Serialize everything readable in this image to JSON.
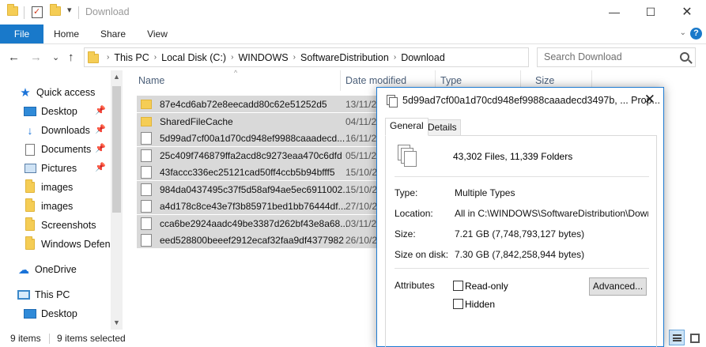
{
  "window": {
    "title": "Download",
    "minimize_glyph": "—",
    "maximize_glyph": "☐",
    "close_glyph": "✕"
  },
  "quick_access_toolbar": {
    "dropdown_glyph": "▾"
  },
  "ribbon": {
    "tabs": [
      "File",
      "Home",
      "Share",
      "View"
    ],
    "expand_glyph": "⌄",
    "help_glyph": "?"
  },
  "navigation": {
    "back_glyph": "←",
    "forward_glyph": "→",
    "recent_glyph": "⌄",
    "up_glyph": "↑",
    "breadcrumb": [
      "This PC",
      "Local Disk (C:)",
      "WINDOWS",
      "SoftwareDistribution",
      "Download"
    ],
    "breadcrumb_separator": "›",
    "search_placeholder": "Search Download"
  },
  "nav_pane": {
    "items": [
      {
        "label": "Quick access",
        "icon": "star-icon",
        "pinned": false
      },
      {
        "label": "Desktop",
        "icon": "desktop-icon",
        "pinned": true
      },
      {
        "label": "Downloads",
        "icon": "download-icon",
        "pinned": true
      },
      {
        "label": "Documents",
        "icon": "documents-icon",
        "pinned": true
      },
      {
        "label": "Pictures",
        "icon": "pictures-icon",
        "pinned": true
      },
      {
        "label": "images",
        "icon": "folder-icon",
        "pinned": false
      },
      {
        "label": "images",
        "icon": "folder-icon",
        "pinned": false
      },
      {
        "label": "Screenshots",
        "icon": "folder-icon",
        "pinned": false
      },
      {
        "label": "Windows Defend",
        "icon": "folder-icon",
        "pinned": false
      },
      {
        "label": "OneDrive",
        "icon": "cloud-icon",
        "pinned": false
      },
      {
        "label": "This PC",
        "icon": "computer-icon",
        "pinned": false
      },
      {
        "label": "Desktop",
        "icon": "desktop-icon",
        "pinned": false
      }
    ],
    "pin_glyph": "📌"
  },
  "file_list": {
    "columns": [
      "Name",
      "Date modified",
      "Type",
      "Size"
    ],
    "sort_glyph": "^",
    "rows": [
      {
        "name": "87e4cd6ab72e8eecadd80c62e51252d5",
        "date": "13/11/2",
        "kind": "folder"
      },
      {
        "name": "SharedFileCache",
        "date": "04/11/2",
        "kind": "folder"
      },
      {
        "name": "5d99ad7cf00a1d70cd948ef9988caaadecd...",
        "date": "16/11/2",
        "kind": "file"
      },
      {
        "name": "25c409f746879ffa2acd8c9273eaa470c6dfd",
        "date": "05/11/2",
        "kind": "file"
      },
      {
        "name": "43faccc336ec25121cad50ff4ccb5b94bfff5",
        "date": "15/10/2",
        "kind": "file"
      },
      {
        "name": "984da0437495c37f5d58af94ae5ec6911002...",
        "date": "15/10/2",
        "kind": "file"
      },
      {
        "name": "a4d178c8ce43e7f3b85971bed1bb76444df...",
        "date": "27/10/2",
        "kind": "file"
      },
      {
        "name": "cca6be2924aadc49be3387d262bf43e8a68...",
        "date": "03/11/2",
        "kind": "file"
      },
      {
        "name": "eed528800beeef2912ecaf32faa9df4377982",
        "date": "26/10/2",
        "kind": "file"
      }
    ]
  },
  "status_bar": {
    "item_count": "9 items",
    "selected": "9 items selected"
  },
  "properties_dialog": {
    "title": "5d99ad7cf00a1d70cd948ef9988caaadecd3497b, ... Prop...",
    "close_glyph": "✕",
    "tabs": [
      "General",
      "Details"
    ],
    "summary": "43,302 Files, 11,339 Folders",
    "type_label": "Type:",
    "type_value": "Multiple Types",
    "location_label": "Location:",
    "location_value": "All in C:\\WINDOWS\\SoftwareDistribution\\Download",
    "size_label": "Size:",
    "size_value": "7.21 GB (7,748,793,127 bytes)",
    "size_on_disk_label": "Size on disk:",
    "size_on_disk_value": "7.30 GB (7,842,258,944 bytes)",
    "attributes_label": "Attributes",
    "readonly_label": "Read-only",
    "hidden_label": "Hidden",
    "advanced_button": "Advanced..."
  },
  "colors": {
    "accent": "#1979ca",
    "selection": "#d9d9d9",
    "folder": "#f5cd55"
  }
}
